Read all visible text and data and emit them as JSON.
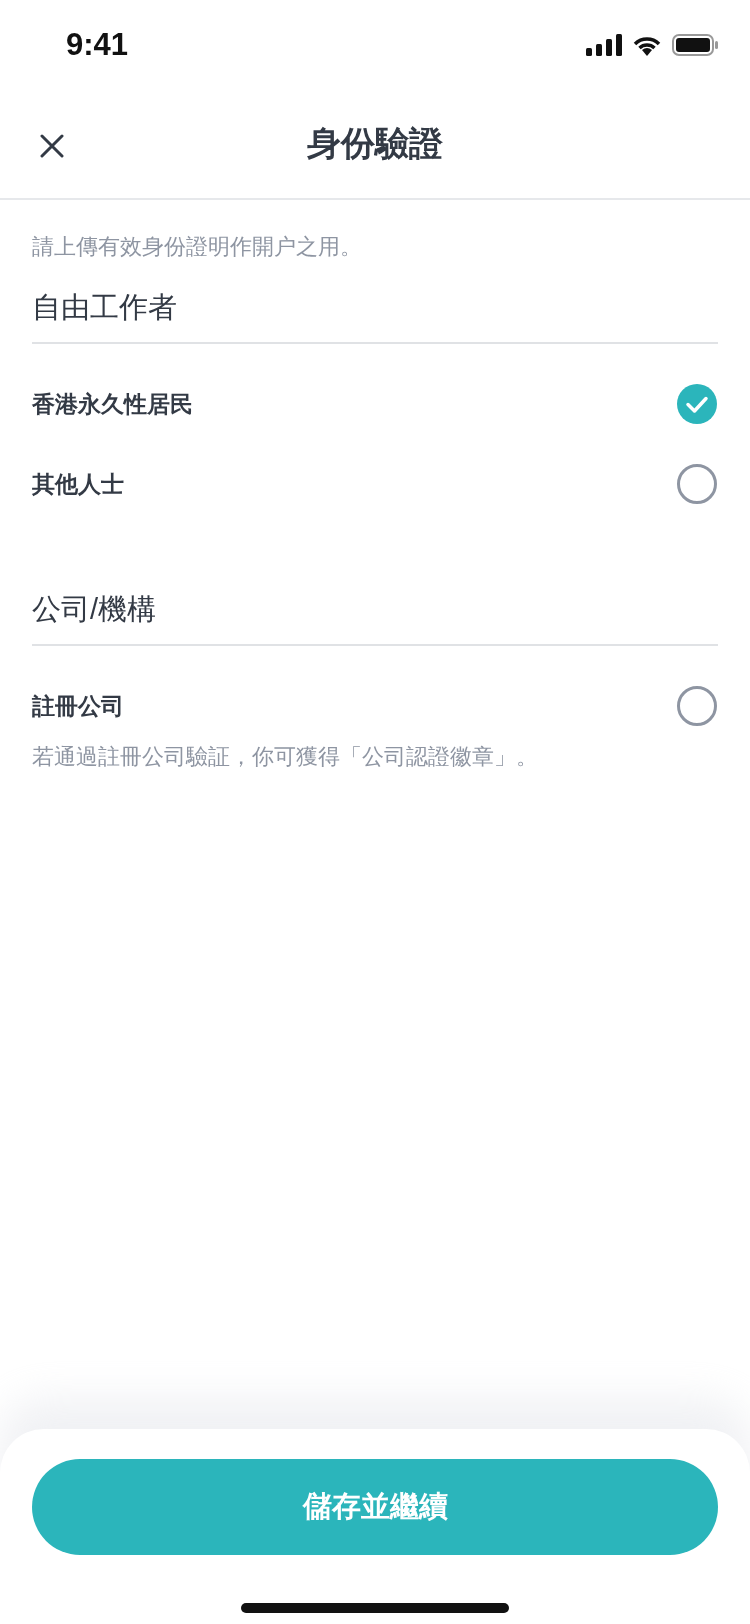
{
  "status_bar": {
    "time": "9:41"
  },
  "header": {
    "title": "身份驗證"
  },
  "intro": "請上傳有效身份證明作開户之用。",
  "sections": [
    {
      "title": "自由工作者",
      "options": [
        {
          "label": "香港永久性居民",
          "selected": true
        },
        {
          "label": "其他人士",
          "selected": false
        }
      ]
    },
    {
      "title": "公司/機構",
      "options": [
        {
          "label": "註冊公司",
          "selected": false,
          "note": "若通過註冊公司驗証，你可獲得「公司認證徽章」。"
        }
      ]
    }
  ],
  "button": {
    "label": "儲存並繼續"
  }
}
